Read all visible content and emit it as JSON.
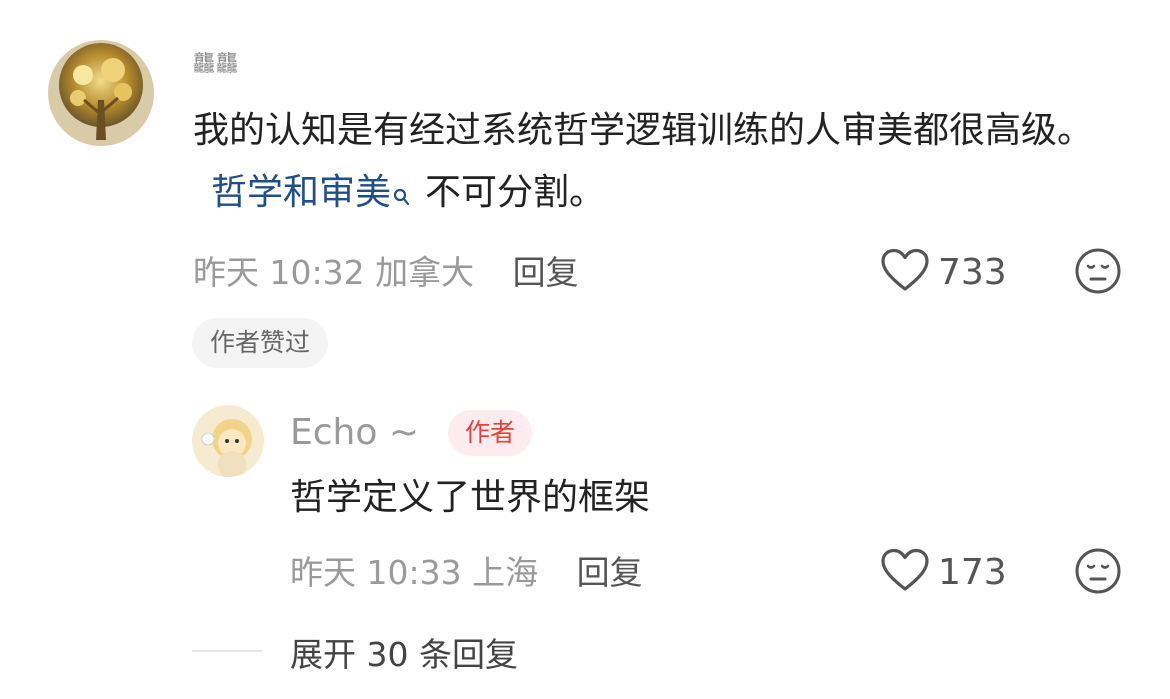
{
  "comment": {
    "username": "龘龘",
    "text": "我的认知是有经过系统哲学逻辑训练的人审美都很高级。",
    "topic_link": "哲学和审美",
    "text_after_link": "不可分割。",
    "time": "昨天 10:32",
    "location": "加拿大",
    "reply_label": "回复",
    "like_count": "733",
    "liked_by_author_label": "作者赞过"
  },
  "reply": {
    "username": "Echo ~",
    "author_badge": "作者",
    "text": "哲学定义了世界的框架",
    "time": "昨天 10:33",
    "location": "上海",
    "reply_label": "回复",
    "like_count": "173"
  },
  "expand_replies_label": "展开 30 条回复",
  "colors": {
    "link": "#1f4f86",
    "badge_text": "#e8413a",
    "badge_bg": "#fdecef",
    "muted": "#9a9a9a"
  },
  "icons": [
    "heart-icon",
    "neutral-face-icon",
    "search-icon"
  ]
}
